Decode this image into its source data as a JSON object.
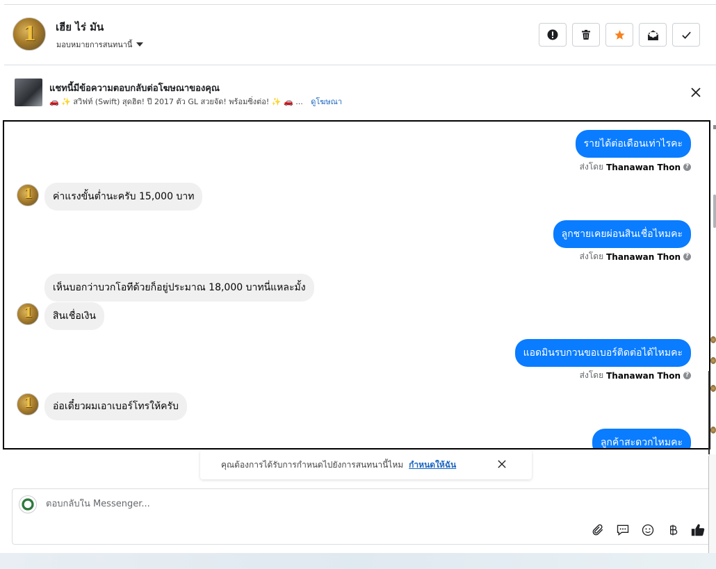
{
  "header": {
    "contact_name": "เฮีย ไร่ มัน",
    "assign_label": "มอบหมายการสนทนานี้",
    "buttons": [
      {
        "name": "spam-button",
        "icon": "exclamation-circle-icon"
      },
      {
        "name": "delete-button",
        "icon": "trash-icon"
      },
      {
        "name": "star-button",
        "icon": "star-icon",
        "color": "#f5821f"
      },
      {
        "name": "mark-unread-button",
        "icon": "envelope-icon"
      },
      {
        "name": "done-button",
        "icon": "check-icon"
      }
    ]
  },
  "ad_banner": {
    "title": "แชทนี้มีข้อความตอบกลับต่อโฆษณาของคุณ",
    "subtitle": "🚗 ✨ สวิฟท์ (Swift) สุดฮิต! ปี 2017 ตัว GL สวยจัด! พร้อมซิ่งต่อ! ✨ 🚗 ...",
    "link": "ดูโฆษณา"
  },
  "messages": [
    {
      "dir": "out",
      "text": "รายได้ต่อเดือนเท่าไรคะ",
      "sent_by_prefix": "ส่งโดย",
      "sender": "Thanawan Thon"
    },
    {
      "dir": "in",
      "text": "ค่าแรงขั้นต่ำนะครับ 15,000 บาท"
    },
    {
      "dir": "out",
      "text": "ลูกชายเคยผ่อนสินเชื่อไหมคะ",
      "sent_by_prefix": "ส่งโดย",
      "sender": "Thanawan Thon"
    },
    {
      "dir": "in",
      "text": "เห็นบอกว่าบวกโอทีด้วยก็อยู่ประมาณ 18,000 บาทนี่แหละมั้ง"
    },
    {
      "dir": "in",
      "text": "สินเชื่อเงิน"
    },
    {
      "dir": "out",
      "text": "แอดมินรบกวนขอเบอร์ติดต่อได้ไหมคะ",
      "sent_by_prefix": "ส่งโดย",
      "sender": "Thanawan Thon"
    },
    {
      "dir": "in",
      "text": "อ่อเดี๋ยวผมเอาเบอร์โทรให้ครับ"
    },
    {
      "dir": "out",
      "text": "ลูกค้าสะดวกไหมคะ"
    }
  ],
  "schedule_prompt": {
    "text": "คุณต้องการได้รับการกำหนดไปยังการสนทนานี้ไหม",
    "link": "กำหนดให้ฉัน"
  },
  "composer": {
    "placeholder": "ตอบกลับใน Messenger...",
    "tools": [
      "paperclip-icon",
      "saved-reply-icon",
      "emoji-icon",
      "baht-icon",
      "thumbs-up-icon"
    ]
  },
  "colors": {
    "outgoing_bubble": "#0a7cff",
    "incoming_bubble": "#f0f0f0",
    "link": "#1a65c0",
    "star": "#f5821f"
  }
}
